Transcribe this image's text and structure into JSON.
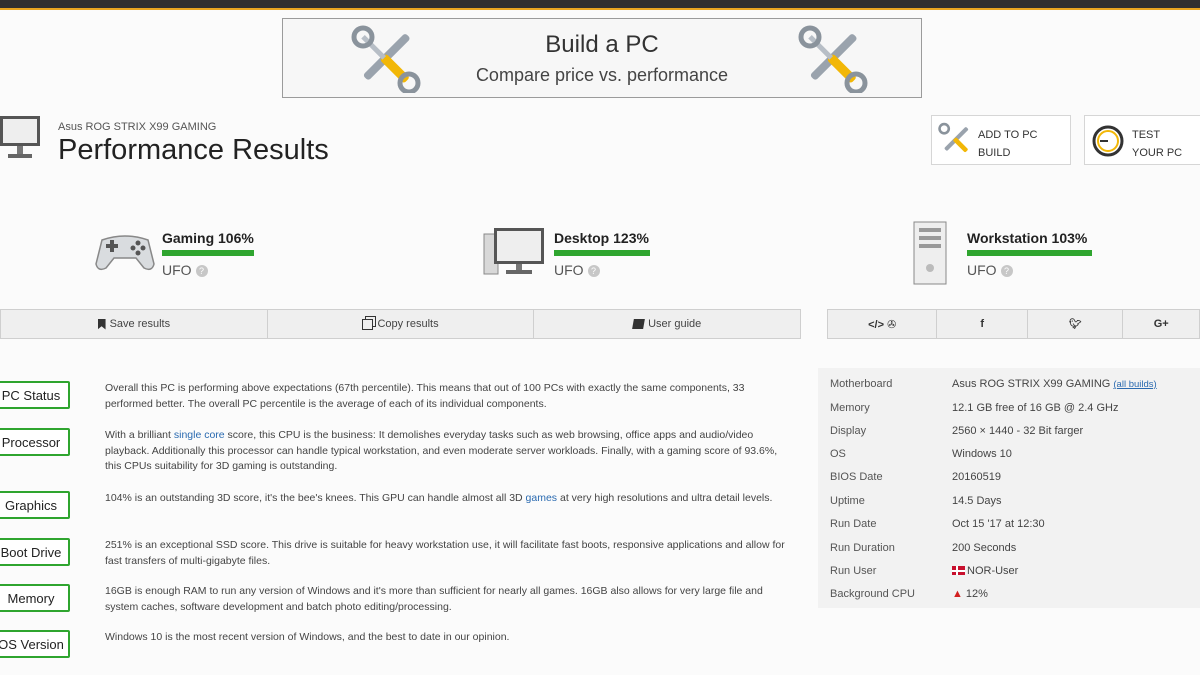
{
  "banner": {
    "title": "Build a PC",
    "subtitle": "Compare price vs. performance"
  },
  "header": {
    "device": "Asus ROG STRIX X99 GAMING",
    "title": "Performance Results"
  },
  "side_buttons": {
    "add_to_build": "ADD TO PC BUILD",
    "test_pc": "TEST YOUR PC"
  },
  "scores": [
    {
      "name": "Gaming 106%",
      "rank": "UFO",
      "fill": 1.0
    },
    {
      "name": "Desktop 123%",
      "rank": "UFO",
      "fill": 1.0
    },
    {
      "name": "Workstation 103%",
      "rank": "UFO",
      "fill": 1.0
    }
  ],
  "actions": {
    "save": "Save results",
    "copy": "Copy results",
    "guide": "User guide"
  },
  "social": {
    "embed": "</> ✇",
    "facebook": "f",
    "twitter": "✉",
    "google": "G+"
  },
  "sections": [
    {
      "label": "PC Status",
      "text": "Overall this PC is performing above expectations (67th percentile). This means that out of 100 PCs with exactly the same components, 33 performed better. The overall PC percentile is the average of each of its individual components."
    },
    {
      "label": "Processor",
      "text_before": "With a brilliant ",
      "link": "single core",
      "text_after": " score, this CPU is the business: It demolishes everyday tasks such as web browsing, office apps and audio/video playback. Additionally this processor can handle typical workstation, and even moderate server workloads. Finally, with a gaming score of 93.6%, this CPUs suitability for 3D gaming is outstanding."
    },
    {
      "label": "Graphics",
      "text_before": "104% is an outstanding 3D score, it's the bee's knees. This GPU can handle almost all 3D ",
      "link": "games",
      "text_after": " at very high resolutions and ultra detail levels."
    },
    {
      "label": "Boot Drive",
      "text": "251% is an exceptional SSD score. This drive is suitable for heavy workstation use, it will facilitate fast boots, responsive applications and allow for fast transfers of multi-gigabyte files."
    },
    {
      "label": "Memory",
      "text": "16GB is enough RAM to run any version of Windows and it's more than sufficient for nearly all games. 16GB also allows for very large file and system caches, software development and batch photo editing/processing."
    },
    {
      "label": "OS Version",
      "text": "Windows 10 is the most recent version of Windows, and the best to date in our opinion."
    }
  ],
  "specs": [
    {
      "key": "Motherboard",
      "value": "Asus ROG STRIX X99 GAMING",
      "link": "(all builds)"
    },
    {
      "key": "Memory",
      "value": "12.1 GB free of 16 GB @ 2.4 GHz"
    },
    {
      "key": "Display",
      "value": "2560 × 1440 - 32 Bit farger"
    },
    {
      "key": "OS",
      "value": "Windows 10"
    },
    {
      "key": "BIOS Date",
      "value": "20160519"
    },
    {
      "key": "Uptime",
      "value": "14.5 Days"
    },
    {
      "key": "Run Date",
      "value": "Oct 15 '17 at 12:30"
    },
    {
      "key": "Run Duration",
      "value": "200 Seconds"
    },
    {
      "key": "Run User",
      "value": "NOR-User"
    },
    {
      "key": "Background CPU",
      "value": "12%"
    }
  ]
}
